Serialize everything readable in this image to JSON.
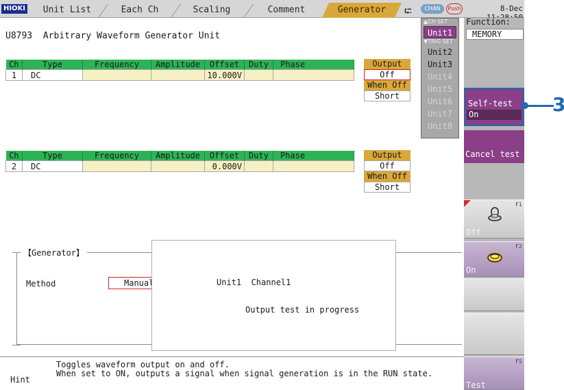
{
  "header": {
    "logo": "HIOKI",
    "tabs": [
      {
        "label": "Unit List"
      },
      {
        "label": "Each Ch"
      },
      {
        "label": "Scaling"
      },
      {
        "label": "Comment"
      },
      {
        "label": "Generator",
        "active": true
      }
    ],
    "chan_badge": "CHAN",
    "push_badge": "Push",
    "datetime": "8-Dec 11:28:50"
  },
  "unit_title": "U8793  Arbitrary Waveform Generator Unit",
  "table_headers": [
    "Ch",
    "Type",
    "Frequency",
    "Amplitude",
    "Offset",
    "Duty",
    "Phase"
  ],
  "channels": [
    {
      "ch": "1",
      "type": "DC",
      "frequency": "",
      "amplitude": "",
      "offset": "10.000V",
      "duty": "",
      "phase": "",
      "output_header": "Output",
      "output": "Off",
      "when_off_header": "When Off",
      "when_off": "Short"
    },
    {
      "ch": "2",
      "type": "DC",
      "frequency": "",
      "amplitude": "",
      "offset": "0.000V",
      "duty": "",
      "phase": "",
      "output_header": "Output",
      "output": "Off",
      "when_off_header": "When Off",
      "when_off": "Short"
    }
  ],
  "unit_menu": {
    "chset_label": "▲CH SET",
    "trigset_label": "▼TRIG SET",
    "items": [
      {
        "label": "Unit1",
        "state": "selected"
      },
      {
        "label": "Unit2",
        "state": "enabled"
      },
      {
        "label": "Unit3",
        "state": "enabled"
      },
      {
        "label": "Unit4",
        "state": "disabled"
      },
      {
        "label": "Unit5",
        "state": "disabled"
      },
      {
        "label": "Unit6",
        "state": "disabled"
      },
      {
        "label": "Unit7",
        "state": "disabled"
      },
      {
        "label": "Unit8",
        "state": "disabled"
      }
    ]
  },
  "right_panel": {
    "function_label": "Function:",
    "function_value": "MEMORY",
    "self_test_label": "Self-test",
    "self_test_value": "On",
    "cancel_test": "Cancel test",
    "f1_key": "F1",
    "f1_label": "Off",
    "f2_key": "F2",
    "f2_label": "On",
    "f5_key": "F5",
    "f5_label": "Test"
  },
  "callout": "3",
  "generator": {
    "title": "【Generator】",
    "method_label": "Method",
    "method_value": "Manual"
  },
  "popup": {
    "line1": "Unit1  Channel1",
    "line2": "Output test in progress"
  },
  "hint": {
    "label": "Hint",
    "line1": "Toggles waveform output on and off.",
    "line2": "When set to ON, outputs a signal when signal generation is in the RUN state."
  },
  "colors": {
    "accent_purple": "#8a3f86",
    "tab_active": "#d9a83a",
    "table_header": "#2db356",
    "callout_blue": "#1e6ab4"
  }
}
